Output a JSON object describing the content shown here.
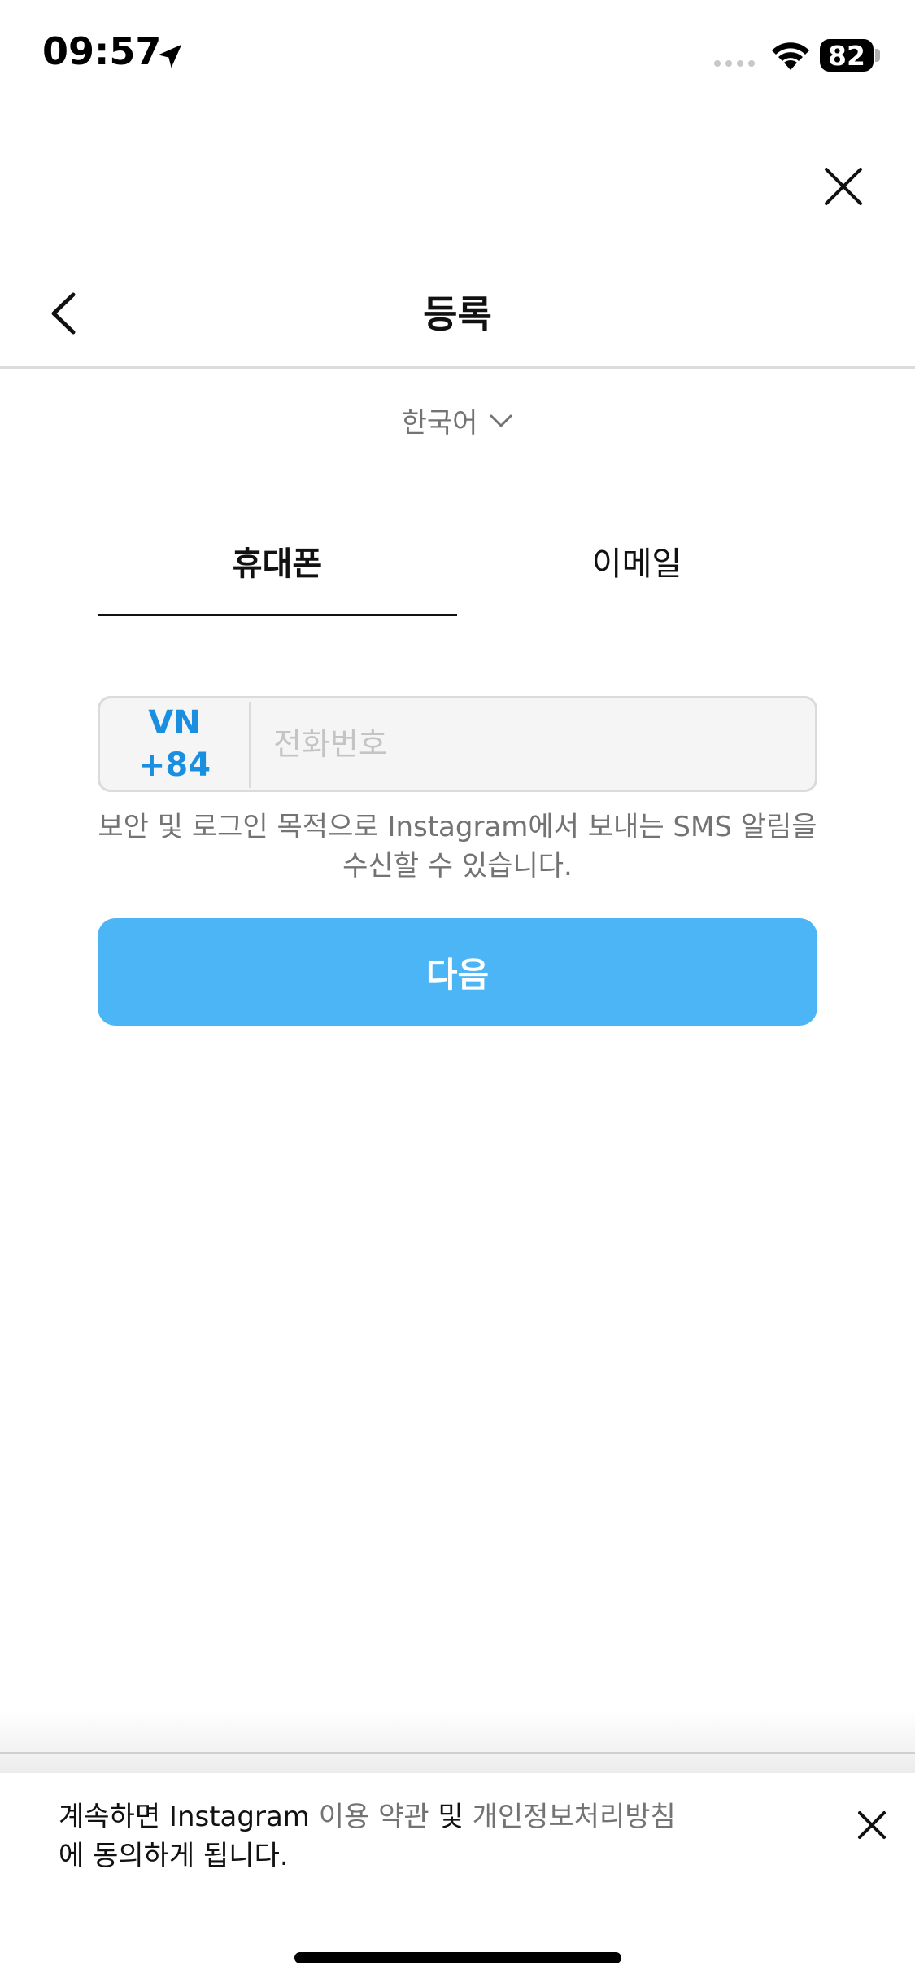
{
  "status_bar": {
    "time": "09:57",
    "battery": "82",
    "icons": [
      "location-arrow-icon",
      "signal-dots-icon",
      "wifi-icon",
      "battery-icon"
    ]
  },
  "header": {
    "title": "등록",
    "back_icon": "chevron-left-icon",
    "close_icon": "close-icon"
  },
  "language": {
    "label": "한국어",
    "icon": "chevron-down-icon"
  },
  "tabs": [
    {
      "label": "휴대폰",
      "active": true
    },
    {
      "label": "이메일",
      "active": false
    }
  ],
  "phone": {
    "country": "VN",
    "dial_code": "+84",
    "placeholder": "전화번호",
    "value": ""
  },
  "sms_note": "보안 및 로그인 목적으로 Instagram에서 보내는 SMS 알림을 수신할 수 있습니다.",
  "next_button": {
    "label": "다음",
    "color": "#4cb5f5"
  },
  "terms": {
    "prefix": "계속하면 Instagram ",
    "terms_link": "이용 약관",
    "middle": " 및 ",
    "privacy_link": "개인정보처리방침",
    "suffix": "에 동의하게 됩니다."
  },
  "colors": {
    "accent": "#1a8fe0",
    "button": "#4cb5f5",
    "muted_text": "#737373"
  }
}
